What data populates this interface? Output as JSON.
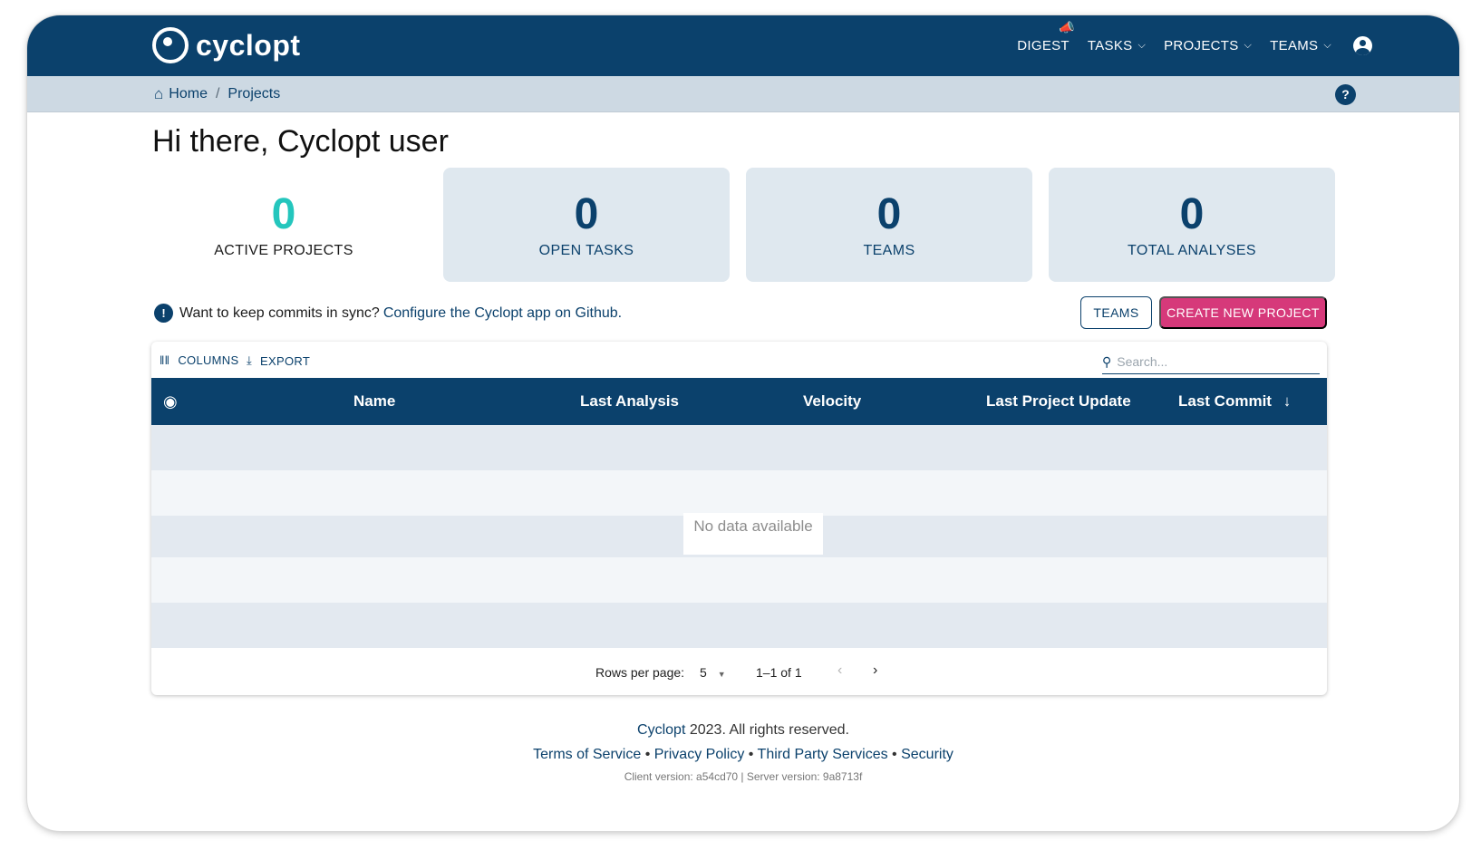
{
  "app": {
    "name": "cyclopt"
  },
  "nav": {
    "digest": "DIGEST",
    "tasks": "TASKS",
    "projects": "PROJECTS",
    "teams": "TEAMS"
  },
  "breadcrumb": {
    "home": "Home",
    "separator": "/",
    "current": "Projects"
  },
  "help": "?",
  "greeting": "Hi there, Cyclopt user",
  "stats": [
    {
      "value": "0",
      "label": "ACTIVE PROJECTS"
    },
    {
      "value": "0",
      "label": "OPEN TASKS"
    },
    {
      "value": "0",
      "label": "TEAMS"
    },
    {
      "value": "0",
      "label": "TOTAL ANALYSES"
    }
  ],
  "sync": {
    "text": "Want to keep commits in sync?",
    "link": "Configure the Cyclopt app on Github."
  },
  "actions": {
    "teams": "TEAMS",
    "create": "CREATE NEW PROJECT"
  },
  "table": {
    "toolbar": {
      "columns": "COLUMNS",
      "export": "EXPORT"
    },
    "search_placeholder": "Search...",
    "headers": [
      "Name",
      "Last Analysis",
      "Velocity",
      "Last Project Update",
      "Last Commit"
    ],
    "empty_text": "No data available",
    "pagination": {
      "rows_label": "Rows per page:",
      "rows_value": "5",
      "range": "1–1 of 1"
    }
  },
  "footer": {
    "brand": "Cyclopt",
    "rights": "2023. All rights reserved.",
    "links": [
      "Terms of Service",
      "Privacy Policy",
      "Third Party Services",
      "Security"
    ],
    "dot": "•",
    "version": "Client version: a54cd70 | Server version: 9a8713f"
  },
  "colors": {
    "primary": "#0b416c",
    "accent_teal": "#24c6bd",
    "accent_pink": "#d6397a",
    "card_bg": "#dfe8ef"
  },
  "icons": [
    "cyclopt-logo-icon",
    "megaphone-icon",
    "chevron-down-icon",
    "user-account-icon",
    "home-icon",
    "help-icon",
    "info-icon",
    "columns-icon",
    "export-icon",
    "search-icon",
    "eye-icon",
    "sort-arrow-down-icon",
    "chevron-left-icon",
    "chevron-right-icon",
    "dropdown-arrow-icon"
  ]
}
